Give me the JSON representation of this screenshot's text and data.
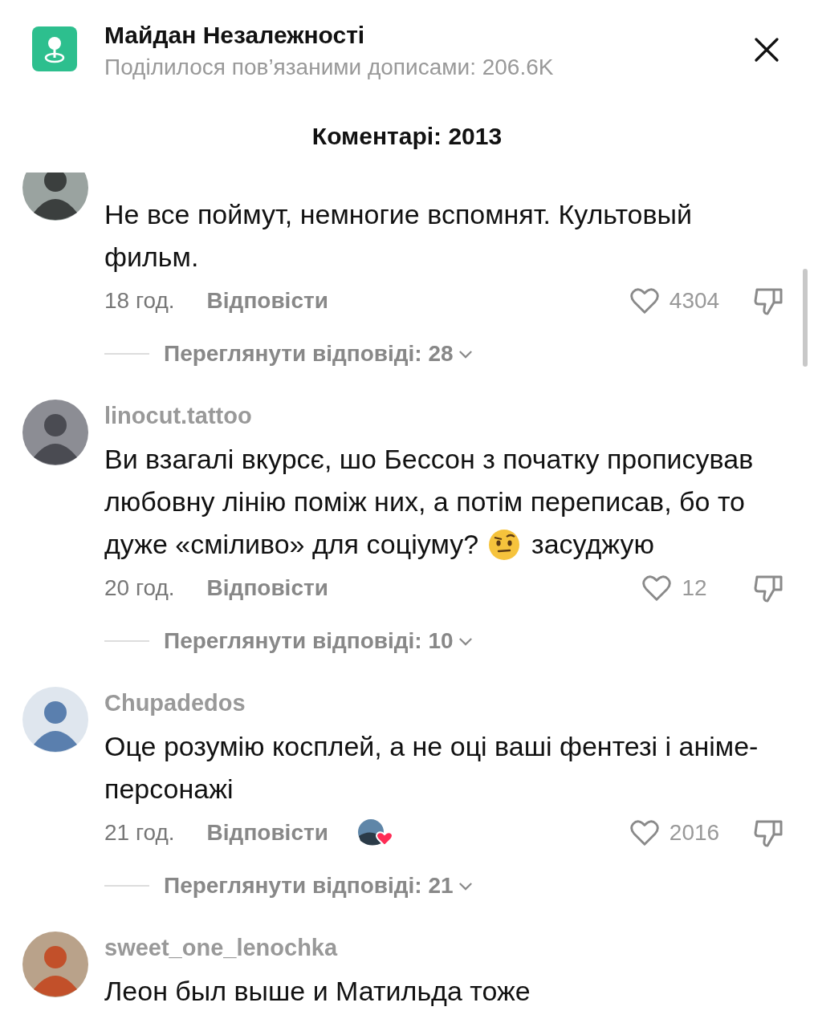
{
  "header": {
    "title": "Майдан Незалежності",
    "subtitle": "Поділилося пов’язаними дописами: 206.6K"
  },
  "comments_title": "Коментарі: 2013",
  "comments": [
    {
      "lines": [
        [
          {
            "kind": "text",
            "value": "Не все поймут, немногие вспомнят. Культовый фильм."
          }
        ]
      ],
      "time": "18 год.",
      "reply": "Відповісти",
      "creator_liked": false,
      "likes": "4304",
      "view_replies": "Переглянути відповіді: 28"
    },
    {
      "username": "linocut.tattoo",
      "lines": [
        [
          {
            "kind": "text",
            "value": "Ви взагалі вкурсє, шо Бессон з початку прописував любовну лінію поміж них, а потім переписав, бо то"
          }
        ],
        [
          {
            "kind": "text",
            "value": "дуже «сміливо» для соціуму?"
          },
          {
            "kind": "emoji"
          },
          {
            "kind": "text",
            "value": "засуджую"
          }
        ]
      ],
      "time": "20 год.",
      "reply": "Відповісти",
      "creator_liked": false,
      "likes": "12",
      "view_replies": "Переглянути відповіді: 10"
    },
    {
      "username": "Chupadedos",
      "lines": [
        [
          {
            "kind": "text",
            "value": "Оце розумію косплей, а не оці ваші фентезі і аніме-персонажі"
          }
        ]
      ],
      "time": "21 год.",
      "reply": "Відповісти",
      "creator_liked": true,
      "likes": "2016",
      "view_replies": "Переглянути відповіді: 21"
    },
    {
      "username": "sweet_one_lenochka",
      "lines": [
        [
          {
            "kind": "text",
            "value": "Леон был выше и Матильда тоже"
          }
        ]
      ]
    }
  ]
}
